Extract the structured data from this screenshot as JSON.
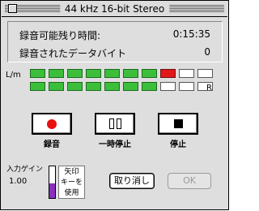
{
  "window": {
    "title": "44 kHz 16-bit Stereo"
  },
  "info": {
    "remaining_label": "録音可能残り時間:",
    "remaining_value": "0:15:35",
    "recorded_label": "録音されたデータバイト",
    "recorded_value": "0"
  },
  "meters": {
    "left_label": "L/m",
    "right_label": "R",
    "left_level": [
      1,
      1,
      1,
      1,
      1,
      1,
      1,
      2,
      0,
      0
    ],
    "right_level": [
      1,
      1,
      1,
      1,
      1,
      1,
      1,
      0,
      0,
      0
    ],
    "colors": {
      "green": "#3bbf3b",
      "red": "#e01818",
      "off": "#ffffff"
    }
  },
  "transport": {
    "record_label": "録音",
    "pause_label": "一時停止",
    "stop_label": "停止",
    "record_icon": "record-dot-icon",
    "pause_icon": "pause-icon",
    "stop_icon": "stop-square-icon"
  },
  "gain": {
    "label": "入力ゲイン",
    "value": "1.00",
    "level_fraction": 0.45,
    "fill_color": "#8a2fbf",
    "hint_lines": [
      "矢印",
      "キーを",
      "使用"
    ]
  },
  "buttons": {
    "cancel": "取り消し",
    "ok": "OK"
  }
}
